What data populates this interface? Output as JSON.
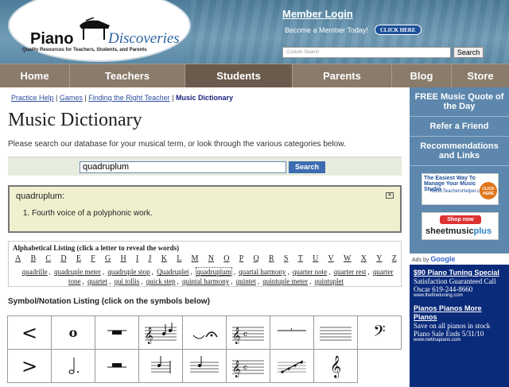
{
  "header": {
    "logo_name": "Piano",
    "logo_name2": "Discoveries",
    "tagline": "Quality Resources for Teachers, Students, and Parents",
    "member_login": "Member Login",
    "become": "Become a Member Today!",
    "click_here": "CLICK HERE",
    "search_placeholder": "Custom Search",
    "search_label": "Search"
  },
  "nav": [
    "Home",
    "Teachers",
    "Students",
    "Parents",
    "Blog",
    "Store"
  ],
  "breadcrumb": {
    "item1": "Practice Help",
    "item2": "Games",
    "item3": "Finding the Right Teacher",
    "current": "Music Dictionary"
  },
  "title": "Music Dictionary",
  "intro": "Please search our database for your musical term, or look through the various categories below.",
  "term_search": {
    "value": "quadruplum",
    "button": "Search"
  },
  "definition": {
    "word": "quadruplum",
    "items": [
      "Fourth voice of a polyphonic work."
    ]
  },
  "alpha": {
    "title": "Alphabetical Listing (click a letter to reveal the words)",
    "letters": [
      "A",
      "B",
      "C",
      "D",
      "E",
      "F",
      "G",
      "H",
      "I",
      "J",
      "K",
      "L",
      "M",
      "N",
      "O",
      "P",
      "Q",
      "R",
      "S",
      "T",
      "U",
      "V",
      "W",
      "X",
      "Y",
      "Z"
    ],
    "words": [
      "quadrille",
      "quadruple meter",
      "quadruple stop",
      "Quadruplet",
      "quadruplum",
      "quartal harmony",
      "quarter note",
      "quarter rest",
      "quarter tone",
      "quartet",
      "qui tollis",
      "quick step",
      "quintal harmony",
      "quintet",
      "quintuple meter",
      "quintuplet"
    ]
  },
  "symbols": {
    "title": "Symbol/Notation Listing (click on the symbols below)"
  },
  "sidebar": {
    "links": [
      "FREE Music Quote of the Day",
      "Refer a Friend",
      "Recommendations and Links"
    ],
    "ad1_t1": "The Easiest Way To Manage Your Music Studio",
    "ad1_t2": "MusicTeachersHelper.com",
    "ad1_btn": "CLICK HERE",
    "ad2_top": "Shop now",
    "ad2_a": "sheetmusic",
    "ad2_b": "plus",
    "adsby": "Ads by",
    "google": "Google",
    "ads": [
      {
        "title": "$90 Piano Tuning Special",
        "body": "Satisfaction Guaranteed Call Oscar 619-244-8660",
        "url": "www.thefinetuning.com"
      },
      {
        "title": "Pianos Pianos More Pianos",
        "body": "Save on all pianos in stock Piano Sale Ends 5/31/10",
        "url": "www.nwtinapiano.com"
      }
    ]
  }
}
